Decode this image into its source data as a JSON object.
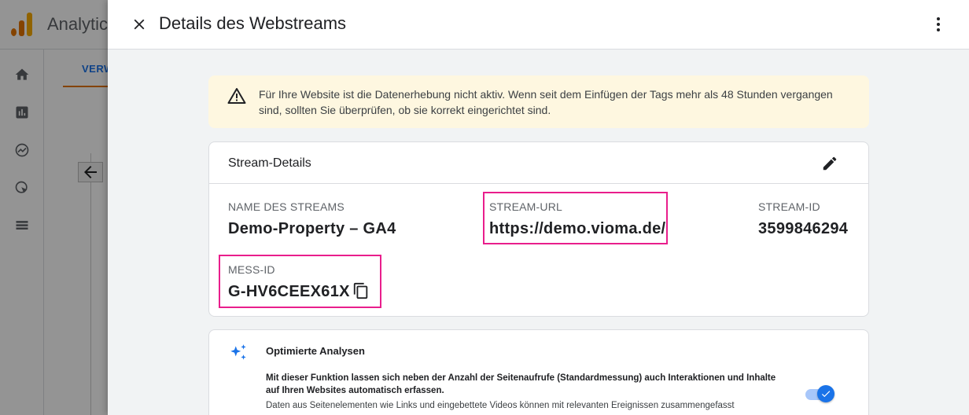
{
  "background": {
    "brand": "Analytics",
    "tab_label": "VERW",
    "accent": "#1a73e8",
    "tab_underline": "#e37400",
    "rail_icons": [
      "home-icon",
      "reports-icon",
      "explore-icon",
      "advertising-icon",
      "list-icon"
    ]
  },
  "drawer": {
    "title": "Details des Webstreams"
  },
  "alert": {
    "icon": "warning-icon",
    "text": "Für Ihre Website ist die Datenerhebung nicht aktiv. Wenn seit dem Einfügen der Tags mehr als 48 Stunden vergangen sind, sollten Sie überprüfen, ob sie korrekt eingerichtet sind.",
    "bg_color": "#fef7e0"
  },
  "stream_details": {
    "title": "Stream-Details",
    "fields": {
      "name_label": "NAME DES STREAMS",
      "name_value": "Demo-Property – GA4",
      "url_label": "STREAM-URL",
      "url_value": "https://demo.vioma.de/",
      "id_label": "STREAM-ID",
      "id_value": "3599846294",
      "mess_label": "MESS-ID",
      "mess_value": "G-HV6CEEX61X"
    },
    "highlight_color": "#e91e8c"
  },
  "optimized": {
    "title": "Optimierte Analysen",
    "desc": "Mit dieser Funktion lassen sich neben der Anzahl der Seitenaufrufe (Standardmessung) auch Interaktionen und Inhalte auf Ihren Websites automatisch erfassen.",
    "desc2": "Daten aus Seitenelementen wie Links und eingebettete Videos können mit relevanten Ereignissen zusammengefasst",
    "toggle_on": true
  }
}
